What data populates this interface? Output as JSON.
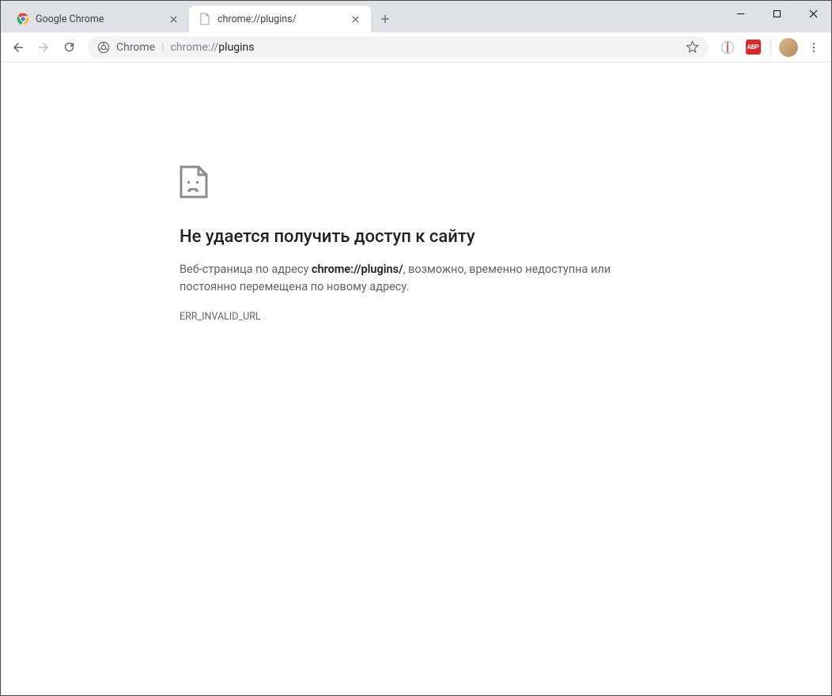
{
  "window": {
    "tabs": [
      {
        "title": "Google Chrome",
        "active": false
      },
      {
        "title": "chrome://plugins/",
        "active": true
      }
    ]
  },
  "omnibox": {
    "chip": "Chrome",
    "url_dim": "chrome://",
    "url_strong": "plugins"
  },
  "extensions": {
    "abp_label": "ABP"
  },
  "error": {
    "title": "Не удается получить доступ к сайту",
    "msg_before": "Веб-страница по адресу ",
    "msg_url": "chrome://plugins/",
    "msg_after": ", возможно, временно недоступна или постоянно перемещена по новому адресу.",
    "code": "ERR_INVALID_URL"
  }
}
